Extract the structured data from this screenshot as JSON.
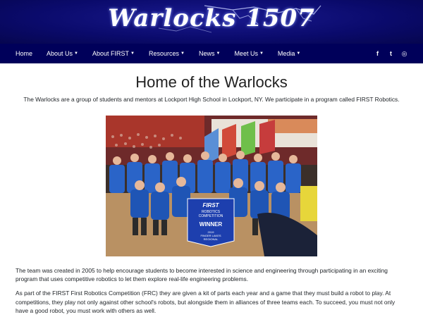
{
  "header": {
    "logo_text": "Warlocks 1507"
  },
  "nav": {
    "items": [
      {
        "label": "Home",
        "dropdown": false
      },
      {
        "label": "About Us",
        "dropdown": true
      },
      {
        "label": "About FIRST",
        "dropdown": true
      },
      {
        "label": "Resources",
        "dropdown": true
      },
      {
        "label": "News",
        "dropdown": true
      },
      {
        "label": "Meet Us",
        "dropdown": true
      },
      {
        "label": "Media",
        "dropdown": true
      }
    ],
    "social": [
      {
        "icon": "facebook-icon",
        "glyph": "f"
      },
      {
        "icon": "twitter-icon",
        "glyph": "t"
      },
      {
        "icon": "instagram-icon",
        "glyph": "◎"
      }
    ]
  },
  "main": {
    "title": "Home of the Warlocks",
    "intro": "The Warlocks are a group of students and mentors at Lockport High School in Lockport, NY. We participate in a program called FIRST Robotics.",
    "photo": {
      "banner_line1": "FIRST",
      "banner_line2": "ROBOTICS",
      "banner_line3": "COMPETITION",
      "banner_award": "WINNER",
      "banner_event1": "2019",
      "banner_event2": "FINGER LAKES",
      "banner_event3": "REGIONAL"
    },
    "paragraphs": [
      "The team was created in 2005 to help encourage students to become interested in science and engineering through participating in an exciting program that uses competitive robotics to let them explore real-life engineering problems.",
      "As part of the FIRST First Robotics Competition (FRC) they are given a kit of parts each year and a game that they must build a robot to play. At competitions, they play not only against other school's robots, but alongside them in alliances of three teams each. To succeed, you must not only have a good robot, you must work with others as well."
    ]
  },
  "colors": {
    "banner_bg": "#0a0a6b",
    "nav_bg": "#00005a",
    "team_shirt": "#2a64c8",
    "floor": "#b99163"
  }
}
